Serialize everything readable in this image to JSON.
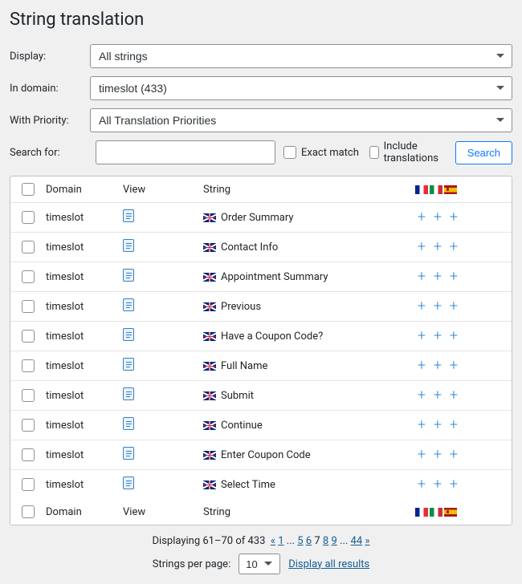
{
  "title": "String translation",
  "filters": {
    "display_label": "Display:",
    "display_value": "All strings",
    "domain_label": "In domain:",
    "domain_value": "timeslot (433)",
    "priority_label": "With Priority:",
    "priority_value": "All Translation Priorities"
  },
  "search": {
    "label": "Search for:",
    "value": "",
    "exact_label": "Exact match",
    "include_label": "Include translations",
    "button": "Search"
  },
  "columns": {
    "domain": "Domain",
    "view": "View",
    "string": "String"
  },
  "lang_header": [
    "flag-fr",
    "flag-it",
    "flag-es"
  ],
  "rows": [
    {
      "domain": "timeslot",
      "string": "Order Summary"
    },
    {
      "domain": "timeslot",
      "string": "Contact Info"
    },
    {
      "domain": "timeslot",
      "string": "Appointment Summary"
    },
    {
      "domain": "timeslot",
      "string": "Previous"
    },
    {
      "domain": "timeslot",
      "string": "Have a Coupon Code?"
    },
    {
      "domain": "timeslot",
      "string": "Full Name"
    },
    {
      "domain": "timeslot",
      "string": "Submit"
    },
    {
      "domain": "timeslot",
      "string": "Continue"
    },
    {
      "domain": "timeslot",
      "string": "Enter Coupon Code"
    },
    {
      "domain": "timeslot",
      "string": "Select Time"
    }
  ],
  "pagination": {
    "summary_prefix": "Displaying 61–70 of 433",
    "links": [
      "«",
      "1",
      "...",
      "5",
      "6",
      "7",
      "8",
      "9",
      "...",
      "44",
      "»"
    ],
    "current": "7",
    "per_page_label": "Strings per page:",
    "per_page_value": "10",
    "display_all": "Display all results"
  }
}
